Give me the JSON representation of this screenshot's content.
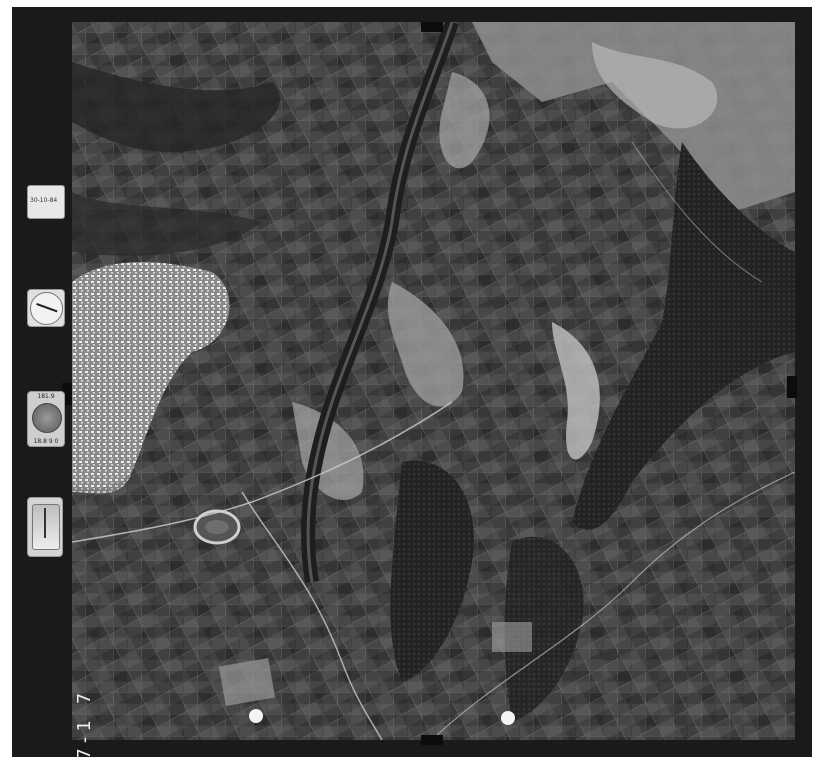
{
  "image": {
    "type": "aerial-photograph",
    "tone": "grayscale",
    "scene": "agricultural"
  },
  "data_strip": {
    "date_text": "30-10-84",
    "frame_number": "7-1 7",
    "level_top": "181.9",
    "level_bottom": "18.8 9 0"
  },
  "colors": {
    "frame": "#1a1a1a",
    "fields_dark": "#2e2e2e",
    "fields_light": "#b5b5b5",
    "town": "#d9d9d9"
  }
}
